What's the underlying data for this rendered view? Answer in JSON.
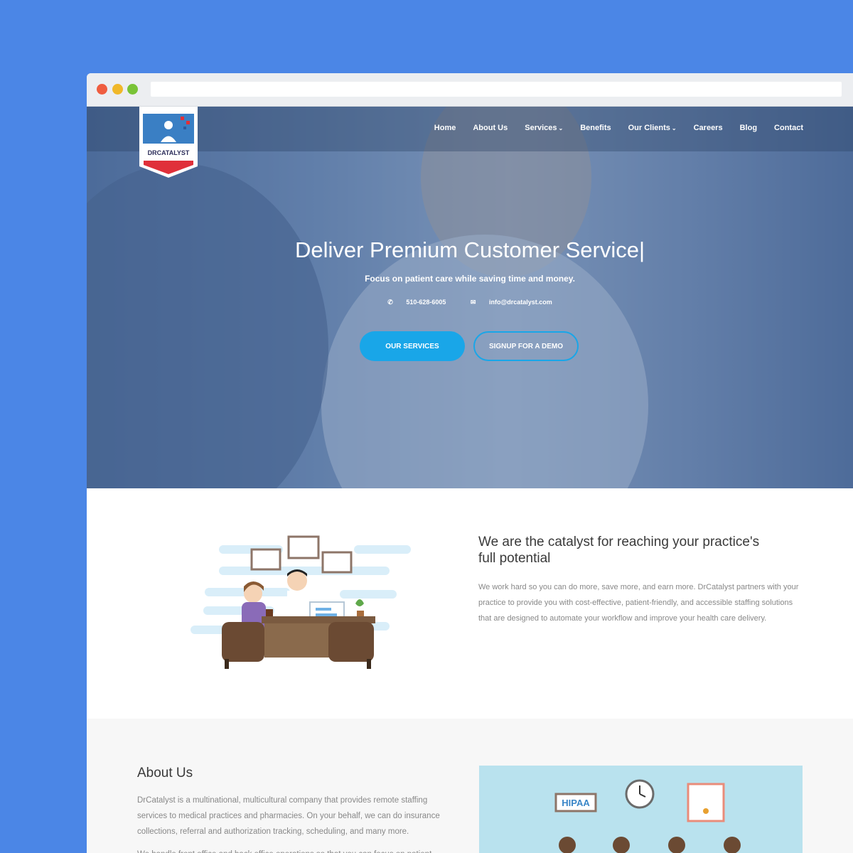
{
  "brand": {
    "logo_text": "DRCATALYST"
  },
  "nav": {
    "items": [
      {
        "label": "Home",
        "dropdown": false
      },
      {
        "label": "About Us",
        "dropdown": false
      },
      {
        "label": "Services",
        "dropdown": true
      },
      {
        "label": "Benefits",
        "dropdown": false
      },
      {
        "label": "Our Clients",
        "dropdown": true
      },
      {
        "label": "Careers",
        "dropdown": false
      },
      {
        "label": "Blog",
        "dropdown": false
      },
      {
        "label": "Contact",
        "dropdown": false
      }
    ]
  },
  "hero": {
    "title": "Deliver Premium Customer Service|",
    "subtitle": "Focus on patient care while saving time and money.",
    "phone": "510-628-6005",
    "email": "info@drcatalyst.com",
    "primary_button": "OUR SERVICES",
    "secondary_button": "SIGNUP FOR A DEMO"
  },
  "intro": {
    "title": "We are the catalyst for reaching your practice's full potential",
    "text": "We work hard so you can do more, save more, and earn more. DrCatalyst partners with your practice to provide you with cost-effective, patient-friendly, and accessible staffing solutions that are designed to automate your workflow and improve your health care delivery."
  },
  "about": {
    "title": "About Us",
    "text": "DrCatalyst is a multinational, multicultural company that provides remote staffing services to medical practices and pharmacies. On your behalf, we can do insurance collections, referral and authorization tracking, scheduling, and many more.",
    "text2": "We handle front office and back office operations so that you can focus on patient",
    "badge": "HIPAA"
  },
  "colors": {
    "accent": "#19a6e8",
    "background": "#4b86e6"
  }
}
